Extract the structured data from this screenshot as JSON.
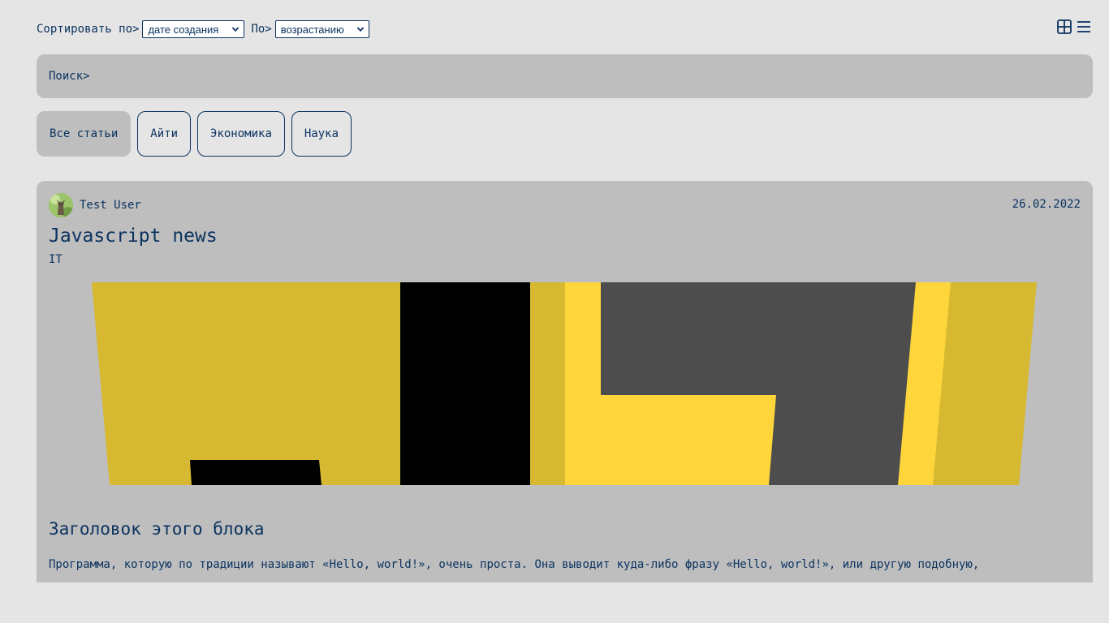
{
  "sort": {
    "label": "Сортировать по>",
    "field_value": "дате создания",
    "order_label": "По>",
    "order_value": "возрастанию"
  },
  "view_toggle": {
    "grid_icon": "grid-icon",
    "list_icon": "list-icon"
  },
  "search": {
    "label": "Поиск>"
  },
  "tags": [
    {
      "label": "Все статьи",
      "active": true
    },
    {
      "label": "Айти",
      "active": false
    },
    {
      "label": "Экономика",
      "active": false
    },
    {
      "label": "Наука",
      "active": false
    }
  ],
  "article": {
    "author": "Test User",
    "date": "26.02.2022",
    "title": "Javascript news",
    "category": "IT",
    "block_title": "Заголовок этого блока",
    "block_text": "Программа, которую по традиции называют «Hello, world!», очень проста. Она выводит куда-либо фразу «Hello, world!», или другую подобную,"
  },
  "colors": {
    "accent": "#0b3360",
    "background": "#e5e5e5",
    "panel": "#bebebe",
    "js_yellow": "#d6b930",
    "js_yellow_bright": "#fed53b",
    "js_dark": "#4d4d4d"
  }
}
